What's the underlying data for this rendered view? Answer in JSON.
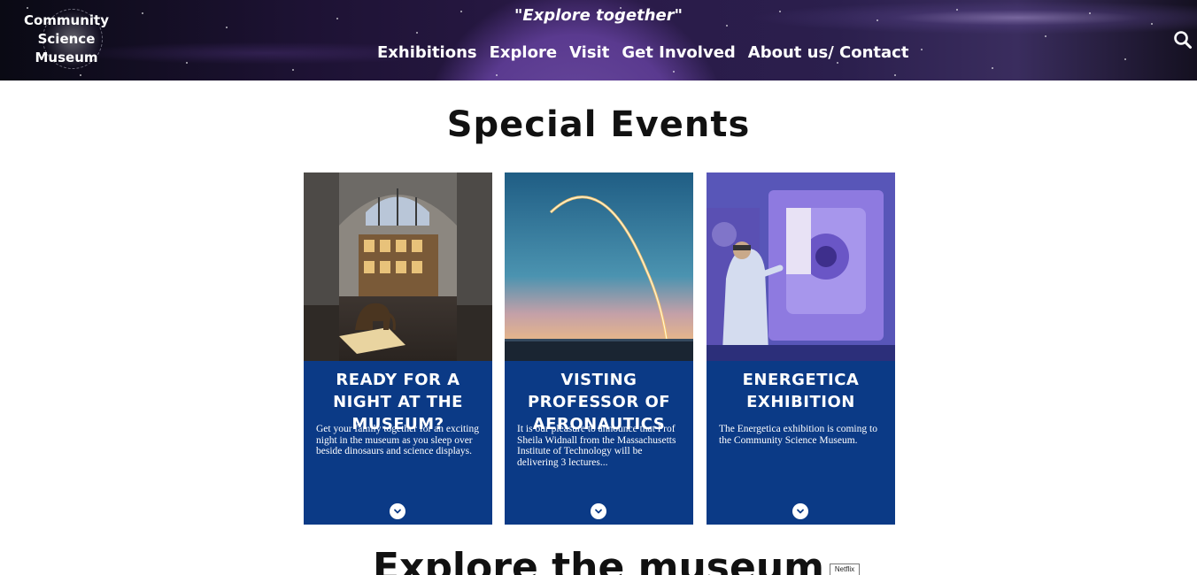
{
  "header": {
    "logo_text": "Community Science Museum",
    "tagline": "\"Explore together\"",
    "nav": [
      {
        "label": "Exhibitions"
      },
      {
        "label": "Explore"
      },
      {
        "label": "Visit"
      },
      {
        "label": "Get Involved"
      },
      {
        "label": "About us/ Contact"
      }
    ],
    "search_icon": "search-icon"
  },
  "main": {
    "section_title": "Special Events",
    "cards": [
      {
        "title": "READY FOR A NIGHT AT THE MUSEUM?",
        "description": "Get your family together for an exciting night in the museum as you sleep over beside dinosaurs and science displays.",
        "image": "museum-rotunda-with-elephant",
        "expand_icon": "chevron-down-icon"
      },
      {
        "title": "VISTING PROFESSOR OF AERONAUTICS",
        "description": "It is our pleasure to announce that Prof Sheila Widnall from the Massachusetts Institute of Technology will be delivering 3 lectures...",
        "image": "rocket-launch-trail",
        "expand_icon": "chevron-down-icon"
      },
      {
        "title": "ENERGETICA EXHIBITION",
        "description": "The Energetica exhibition is coming to the Community Science Museum.",
        "image": "scientist-with-machine",
        "expand_icon": "chevron-down-icon"
      }
    ],
    "next_section_title": "Explore the museum",
    "badge": "Netflix"
  },
  "colors": {
    "card_background": "#0b3a86",
    "header_purple": "#5a3a8f"
  }
}
